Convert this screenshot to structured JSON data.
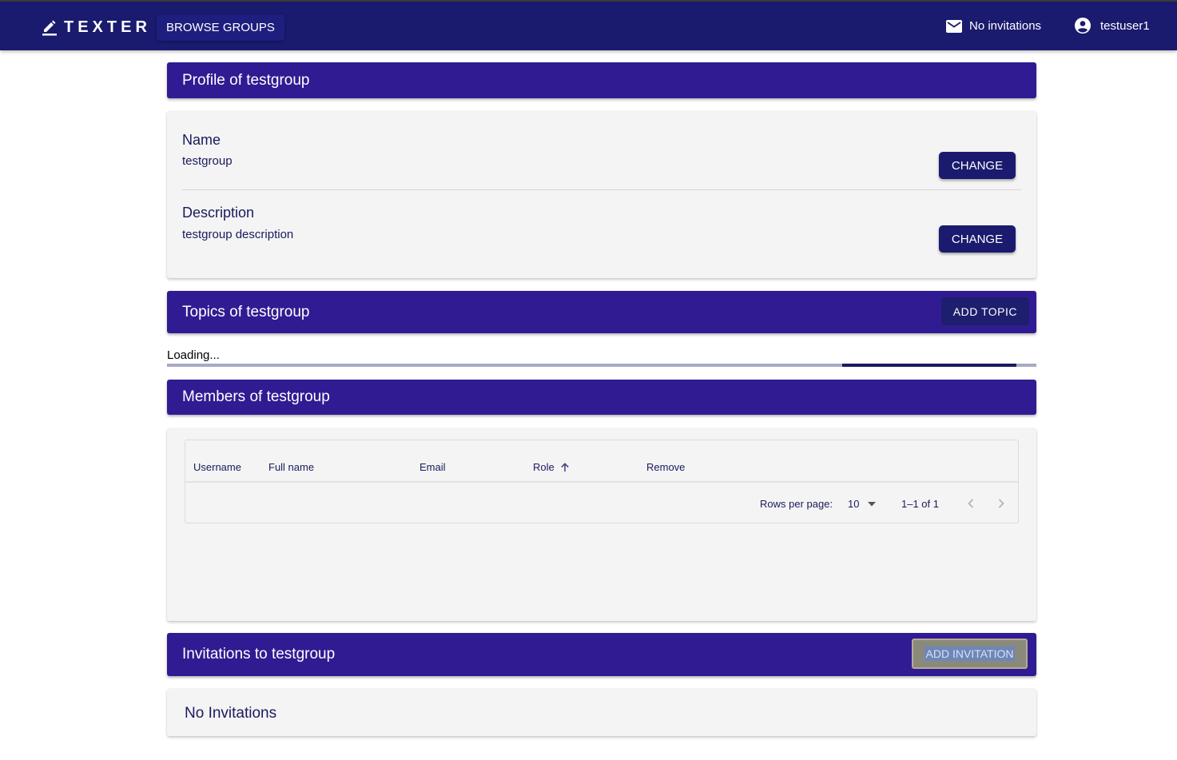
{
  "appbar": {
    "brand": "TEXTER",
    "browse_label": "BROWSE GROUPS",
    "invitations_label": "No invitations",
    "username": "testuser1"
  },
  "profile": {
    "header": "Profile of testgroup",
    "name_label": "Name",
    "name_value": "testgroup",
    "description_label": "Description",
    "description_value": "testgroup description",
    "change_label": "CHANGE"
  },
  "topics": {
    "header": "Topics of testgroup",
    "add_label": "ADD TOPIC",
    "loading_text": "Loading...",
    "progress_indicator": "indeterminate"
  },
  "members": {
    "header": "Members of testgroup",
    "columns": [
      "Username",
      "Full name",
      "Email",
      "Role",
      "Remove"
    ],
    "sorted_column": "Role",
    "sort_direction": "ascending",
    "rows_per_page_label": "Rows per page:",
    "rows_per_page_value": "10",
    "range_text": "1–1 of 1"
  },
  "invitations": {
    "header": "Invitations to testgroup",
    "add_label": "ADD INVITATION",
    "empty_text": "No Invitations"
  },
  "icons": {
    "brand": "pencil-icon",
    "invitations": "mail-icon",
    "user": "account-circle-icon",
    "sort": "arrow-up-icon",
    "dropdown": "caret-down-icon",
    "prev": "chevron-left-icon",
    "next": "chevron-right-icon"
  },
  "colors": {
    "appbar": "#1a1a6e",
    "section_header": "#311b92",
    "button": "#1a1a6e",
    "card": "#f4f4f4"
  }
}
